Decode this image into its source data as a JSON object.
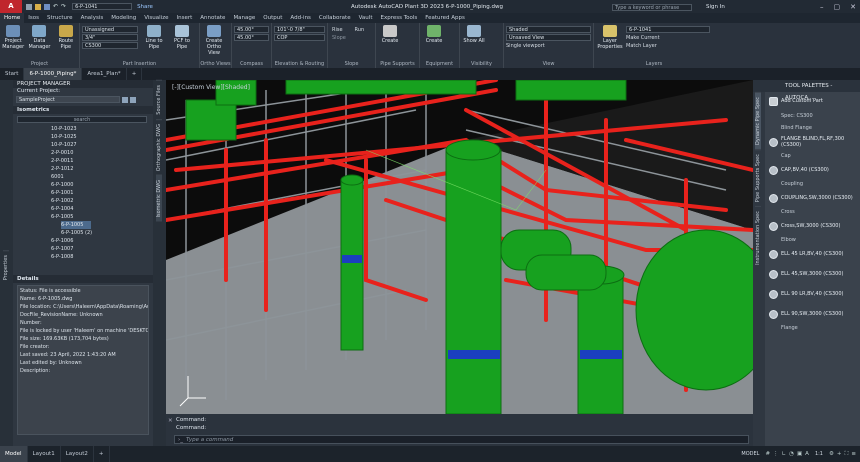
{
  "titlebar": {
    "logo": "A",
    "logo_sub": "PLANT",
    "file_select": "6-P-1041",
    "share": "Share",
    "app_title": "Autodesk AutoCAD Plant 3D 2023   6-P-1000_Piping.dwg",
    "search_placeholder": "Type a keyword or phrase",
    "signin": "Sign In"
  },
  "menu": [
    "Home",
    "Isos",
    "Structure",
    "Analysis",
    "Modeling",
    "Visualize",
    "Insert",
    "Annotate",
    "Manage",
    "Output",
    "Add-ins",
    "Collaborate",
    "Vault",
    "Express Tools",
    "Featured Apps"
  ],
  "ribbon": {
    "project": {
      "label": "Project",
      "btn1": "Project Manager",
      "btn2": "Data Manager",
      "btn3": "Route Pipe"
    },
    "part_insertion": {
      "label": "Part Insertion",
      "spec": "Unassigned",
      "size": "3/4\"",
      "cs": "CS300",
      "line": "Line to Pipe",
      "pcf": "PCF to Pipe"
    },
    "ortho": {
      "label": "Ortho Views",
      "btn": "Create Ortho View"
    },
    "compass": {
      "label": "Compass",
      "a1": "45.00°",
      "a2": "45.00°"
    },
    "elevation": {
      "label": "Elevation & Routing",
      "elev": "101'-0 7/8\"",
      "cop": "COP"
    },
    "slope": {
      "label": "Slope",
      "rise": "Rise",
      "run": "Run",
      "slope": "Slope"
    },
    "supports": {
      "label": "Pipe Supports",
      "btn": "Create"
    },
    "equipment": {
      "label": "Equipment",
      "btn": "Create"
    },
    "visibility": {
      "label": "Visibility",
      "btn": "Show All"
    },
    "view": {
      "label": "View",
      "visual": "Shaded",
      "saved": "Unsaved View",
      "viewport": "Single viewport"
    },
    "layers": {
      "label": "Layers",
      "btn": "Layer Properties",
      "layer": "6-P-1041",
      "make": "Make Current",
      "match": "Match Layer"
    }
  },
  "doctabs": [
    "Start",
    "6-P-1000_Piping*",
    "Area1_Plan*"
  ],
  "pm": {
    "title": "PROJECT MANAGER",
    "current": "Current Project:",
    "project": "SampleProject",
    "section": "Isometrics",
    "search": "search",
    "tree": [
      "10-P-1023",
      "10-P-1025",
      "10-P-1027",
      "2-P-0010",
      "2-P-0011",
      "2-P-1012",
      "6001",
      "6-P-1000",
      "6-P-1001",
      "6-P-1002",
      "6-P-1004",
      "6-P-1005",
      "6-P-1005",
      "6-P-1005 (2)",
      "6-P-1006",
      "6-P-1007",
      "6-P-1008"
    ],
    "details_title": "Details",
    "details": [
      "Status: File is accessible",
      "Name: 6-P-1005.dwg",
      "File location: C:\\Users\\Haleem\\AppData\\Roaming\\Au",
      "DocFile_RevisionName: Unknown",
      "Number:",
      "File is locked by user 'Haleem' on machine 'DESKTOP",
      "File size: 169.63KB (173,704 bytes)",
      "File creator:",
      "Last saved: 23 April, 2022 1:43:20 AM",
      "Last edited by: Unknown",
      "Description:"
    ]
  },
  "pmtabs": [
    "Source Files",
    "Orthographic DWG",
    "Isometric DWG"
  ],
  "leftstrip": "Properties",
  "viewport": {
    "label": "[-][Custom View][Shaded]"
  },
  "cmd": {
    "line1": "Command:",
    "line2": "Command:",
    "placeholder": "Type a command"
  },
  "tp": {
    "title": "TOOL PALETTES - AUTOCA...",
    "add": "Add Custom Part",
    "spec": "Spec: CS300",
    "sections": [
      {
        "h": "Blind Flange",
        "items": [
          "FLANGE BLIND,FL,RF,300 (CS300)"
        ]
      },
      {
        "h": "Cap",
        "items": [
          "CAP,BV,40 (CS300)"
        ]
      },
      {
        "h": "Coupling",
        "items": [
          "COUPLING,SW,3000 (CS300)"
        ]
      },
      {
        "h": "Cross",
        "items": [
          "Cross,SW,3000 (CS300)"
        ]
      },
      {
        "h": "Elbow",
        "items": [
          "ELL 45 LR,BV,40 (CS300)",
          "ELL 45,SW,3000 (CS300)",
          "ELL 90 LR,BV,40 (CS300)",
          "ELL 90,SW,3000 (CS300)"
        ]
      },
      {
        "h": "Flange",
        "items": []
      }
    ],
    "vtabs": [
      "Dynamic Pipe Spec",
      "Pipe Supports Spec",
      "Instrumentation Spec"
    ]
  },
  "status": {
    "tabs": [
      "Model",
      "Layout1",
      "Layout2"
    ],
    "model": "MODEL",
    "scale": "1:1"
  }
}
